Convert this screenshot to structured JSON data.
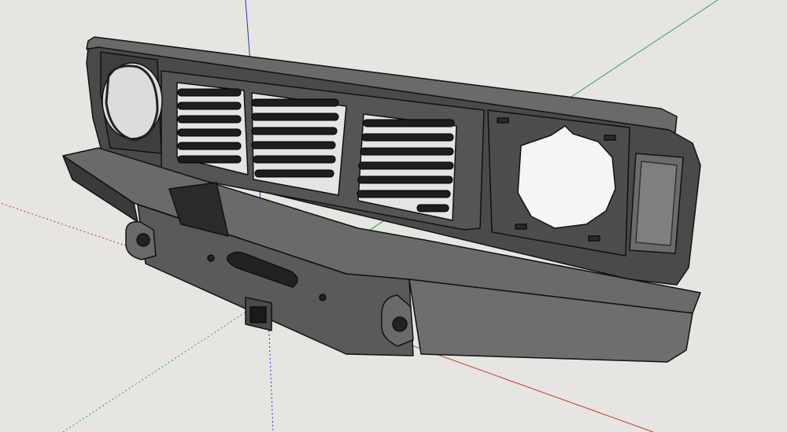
{
  "viewport": {
    "background": "#e6e5e1",
    "axes": {
      "red": "#c0392b",
      "green": "#2ea043",
      "blue": "#2233c8"
    },
    "model": {
      "fill_dark": "#3c3c3c",
      "fill_mid": "#5a5a5a",
      "fill_light": "#808080",
      "edge": "#111111"
    }
  }
}
